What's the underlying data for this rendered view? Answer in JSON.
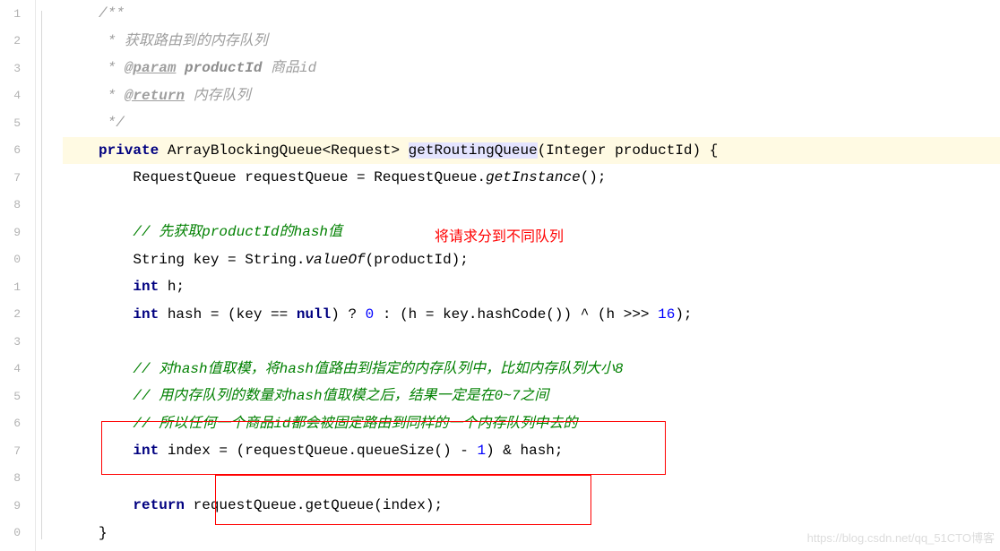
{
  "gutter": {
    "numbers": [
      "1",
      "2",
      "3",
      "4",
      "5",
      "6",
      "7",
      "8",
      "9",
      "0",
      "1",
      "2",
      "3",
      "4",
      "5",
      "6",
      "7",
      "8",
      "9",
      "0"
    ]
  },
  "code": {
    "l1_open": "/**",
    "l2_star": " * ",
    "l2_text": "获取路由到的内存队列",
    "l3_star": " * ",
    "l3_tag": "@param",
    "l3_param": " productId",
    "l3_desc": " 商品id",
    "l4_star": " * ",
    "l4_tag": "@return",
    "l4_desc": " 内存队列",
    "l5_close": " */",
    "l6_kw": "private",
    "l6_type": " ArrayBlockingQueue<Request> ",
    "l6_method": "getRoutingQueue",
    "l6_params": "(Integer productId) {",
    "l7": "    RequestQueue requestQueue = RequestQueue.",
    "l7_static": "getInstance",
    "l7_end": "();",
    "l9": "    // 先获取productId的hash值",
    "l10_a": "    String key = String.",
    "l10_static": "valueOf",
    "l10_b": "(productId);",
    "l11_kw": "    int",
    "l11_rest": " h;",
    "l12_kw1": "    int",
    "l12_a": " hash = (key == ",
    "l12_kw2": "null",
    "l12_b": ") ? ",
    "l12_n1": "0",
    "l12_c": " : (h = key.hashCode()) ^ (h >>> ",
    "l12_n2": "16",
    "l12_d": ");",
    "l14": "    // 对hash值取模，将hash值路由到指定的内存队列中，比如内存队列大小8",
    "l15": "    // 用内存队列的数量对hash值取模之后，结果一定是在0~7之间",
    "l16": "    // 所以任何一个商品id都会被固定路由到同样的一个内存队列中去的",
    "l17_kw": "    int",
    "l17_a": " index = (requestQueue.queueSize() - ",
    "l17_n": "1",
    "l17_b": ") & hash;",
    "l19_kw": "    return",
    "l19_a": " requestQueue.getQueue(index);",
    "l20": "}"
  },
  "annotation": {
    "red_text": "将请求分到不同队列"
  },
  "watermark": "https://blog.csdn.net/qq_51CTO博客"
}
